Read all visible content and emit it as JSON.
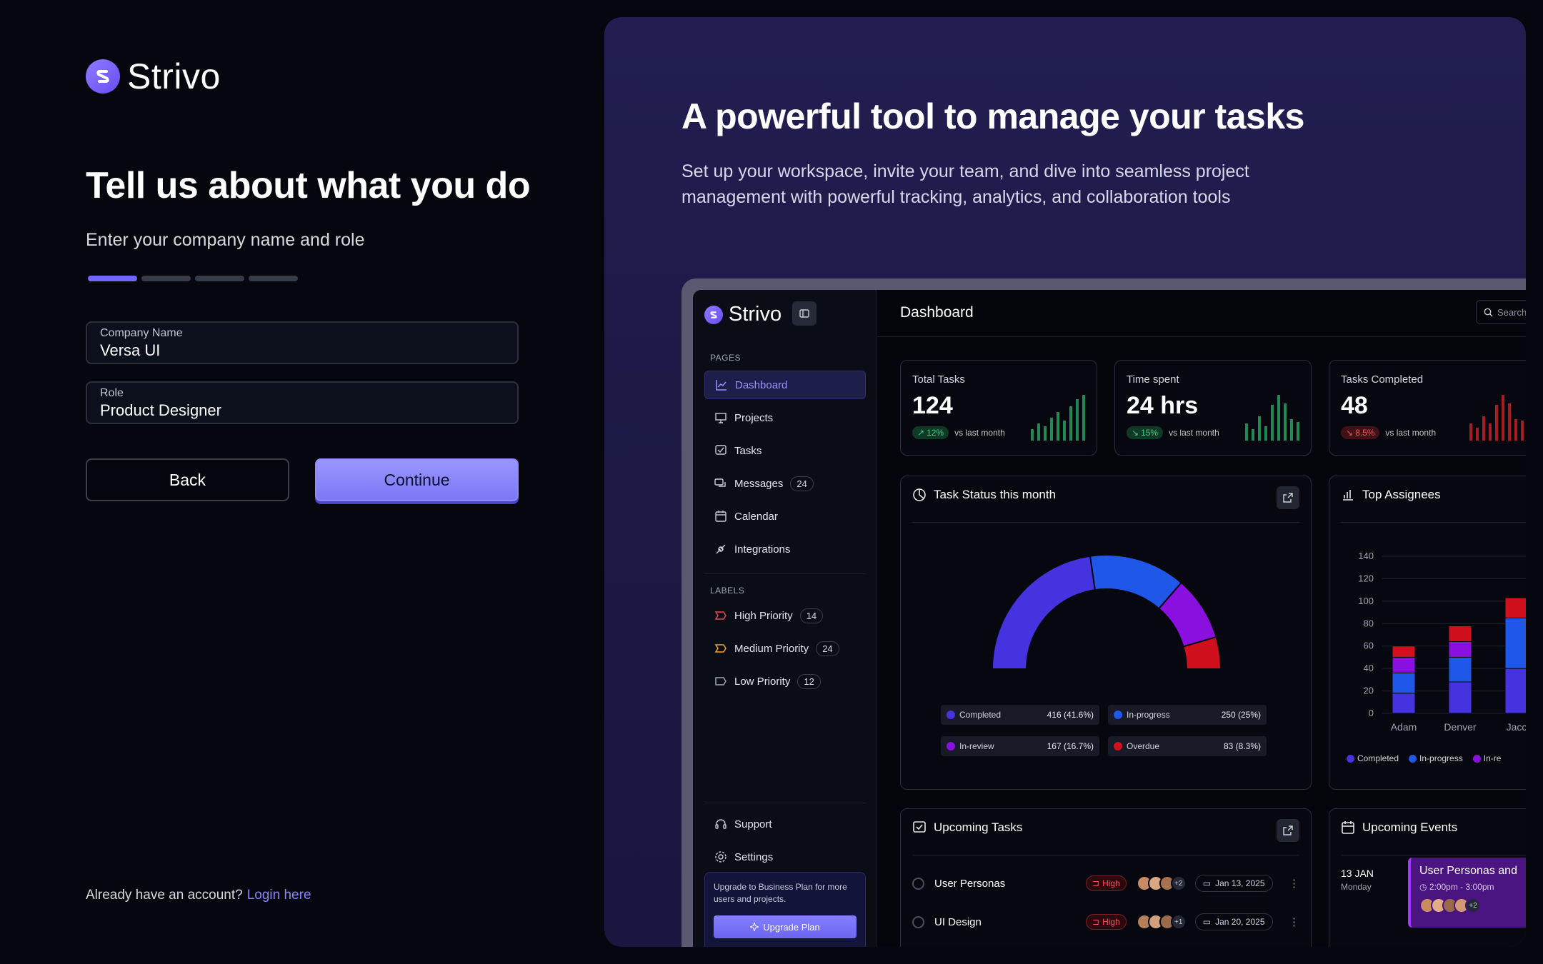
{
  "brand": {
    "name": "Strivo"
  },
  "onboarding": {
    "title": "Tell us about what you do",
    "subtitle": "Enter your company name and role",
    "steps_total": 4,
    "step_current": 1,
    "company_label": "Company Name",
    "company_value": "Versa UI",
    "role_label": "Role",
    "role_value": "Product Designer",
    "back_label": "Back",
    "continue_label": "Continue",
    "login_prompt": "Already have an account?",
    "login_link": "Login here"
  },
  "promo": {
    "heading": "A powerful tool to manage your tasks",
    "text": "Set up your workspace, invite your team, and dive into seamless project management with powerful tracking, analytics, and collaboration tools"
  },
  "dashboard": {
    "title": "Dashboard",
    "search_placeholder": "Search",
    "sidebar": {
      "pages_label": "PAGES",
      "pages": [
        {
          "label": "Dashboard",
          "icon": "chart-icon"
        },
        {
          "label": "Projects",
          "icon": "presentation-icon"
        },
        {
          "label": "Tasks",
          "icon": "checklist-icon"
        },
        {
          "label": "Messages",
          "icon": "messages-icon",
          "badge": "24"
        },
        {
          "label": "Calendar",
          "icon": "calendar-icon"
        },
        {
          "label": "Integrations",
          "icon": "plug-icon"
        }
      ],
      "labels_label": "LABELS",
      "labels": [
        {
          "label": "High Priority",
          "badge": "14",
          "color": "#e5484d"
        },
        {
          "label": "Medium Priority",
          "badge": "24",
          "color": "#f5a524"
        },
        {
          "label": "Low Priority",
          "badge": "12",
          "color": "#a0a3b1"
        }
      ],
      "support": "Support",
      "settings": "Settings",
      "upgrade_text": "Upgrade to Business Plan for more users and projects.",
      "upgrade_button": "Upgrade Plan"
    },
    "stats": [
      {
        "label": "Total Tasks",
        "value": "124",
        "change": "12%",
        "direction": "up",
        "note": "vs last month"
      },
      {
        "label": "Time spent",
        "value": "24 hrs",
        "change": "15%",
        "direction": "up",
        "note": "vs last month"
      },
      {
        "label": "Tasks Completed",
        "value": "48",
        "change": "8.5%",
        "direction": "down",
        "note": "vs last month"
      }
    ],
    "task_status": {
      "title": "Task Status this month",
      "legend": [
        {
          "label": "Completed",
          "value": "416 (41.6%)",
          "color": "#4533e0"
        },
        {
          "label": "In-progress",
          "value": "250 (25%)",
          "color": "#1f57e8"
        },
        {
          "label": "In-review",
          "value": "167 (16.7%)",
          "color": "#8a10e0"
        },
        {
          "label": "Overdue",
          "value": "83 (8.3%)",
          "color": "#d0101c"
        }
      ]
    },
    "top_assignees": {
      "title": "Top Assignees",
      "legend": [
        "Completed",
        "In-progress",
        "In-re"
      ]
    },
    "upcoming_tasks": {
      "title": "Upcoming Tasks",
      "rows": [
        {
          "name": "User Personas",
          "priority": "High",
          "extra": "+2",
          "date": "Jan 13, 2025"
        },
        {
          "name": "UI Design",
          "priority": "High",
          "extra": "+1",
          "date": "Jan 20, 2025"
        }
      ]
    },
    "upcoming_events": {
      "title": "Upcoming Events",
      "date": "13 JAN",
      "weekday": "Monday",
      "event_title": "User Personas and",
      "event_time": "2:00pm - 3:00pm",
      "event_extra": "+2"
    }
  },
  "chart_data": [
    {
      "type": "pie",
      "title": "Task Status this month",
      "categories": [
        "Completed",
        "In-progress",
        "In-review",
        "Overdue"
      ],
      "values": [
        416,
        250,
        167,
        83
      ],
      "colors": [
        "#4533e0",
        "#1f57e8",
        "#8a10e0",
        "#d0101c"
      ]
    },
    {
      "type": "bar",
      "title": "Top Assignees",
      "categories": [
        "Adam",
        "Denver",
        "Jacc"
      ],
      "ylim": [
        0,
        140
      ],
      "yticks": [
        0,
        20,
        40,
        60,
        80,
        100,
        120,
        140
      ],
      "series": [
        {
          "name": "Completed",
          "values": [
            18,
            28,
            40
          ],
          "color": "#4533e0"
        },
        {
          "name": "In-progress",
          "values": [
            18,
            22,
            45
          ],
          "color": "#1f57e8"
        },
        {
          "name": "In-review",
          "values": [
            14,
            14,
            0
          ],
          "color": "#8a10e0"
        },
        {
          "name": "Overdue",
          "values": [
            10,
            14,
            18
          ],
          "color": "#d0101c"
        }
      ]
    }
  ]
}
